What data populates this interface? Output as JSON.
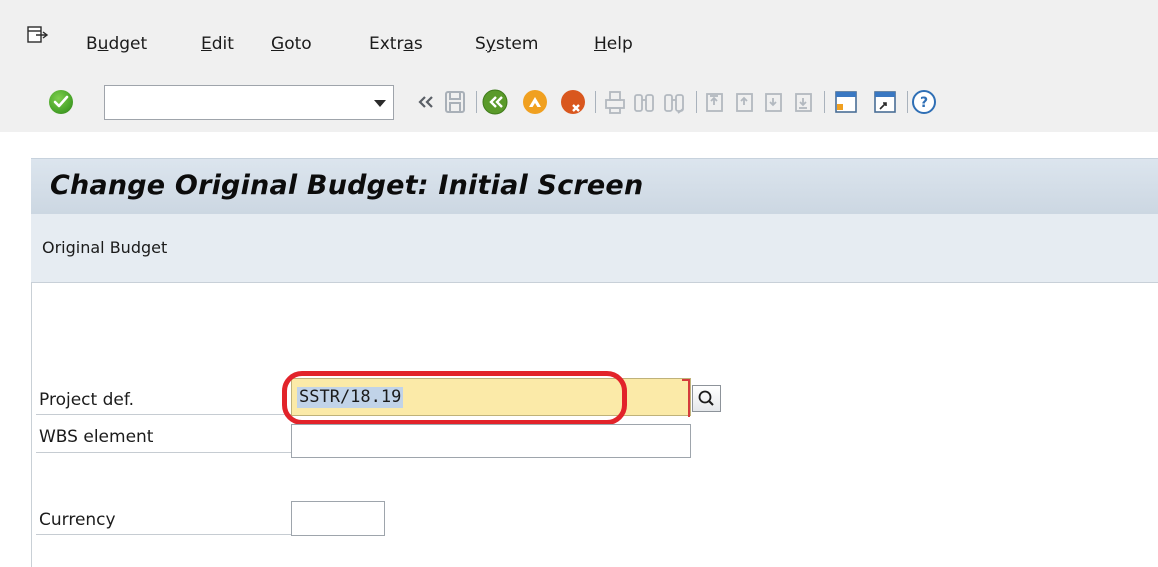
{
  "menu": {
    "items": [
      {
        "pre": "B",
        "ul": "u",
        "post": "dget"
      },
      {
        "pre": "",
        "ul": "E",
        "post": "dit"
      },
      {
        "pre": "",
        "ul": "G",
        "post": "oto"
      },
      {
        "pre": "Extr",
        "ul": "a",
        "post": "s"
      },
      {
        "pre": "S",
        "ul": "y",
        "post": "stem"
      },
      {
        "pre": "",
        "ul": "H",
        "post": "elp"
      }
    ]
  },
  "toolbar": {
    "command_value": "",
    "icons": [
      "enter-icon",
      "back-double-arrow-icon",
      "save-icon",
      "back-icon",
      "exit-icon",
      "cancel-icon",
      "print-icon",
      "find-icon",
      "find-next-icon",
      "first-page-icon",
      "previous-page-icon",
      "next-page-icon",
      "last-page-icon",
      "create-session-icon",
      "generate-shortcut-icon",
      "help-icon"
    ],
    "colors": {
      "enter": "#4aa52a",
      "back": "#5a9a2a",
      "exit": "#f0a020",
      "cancel": "#d9571e"
    }
  },
  "title": "Change Original Budget: Initial Screen",
  "application_toolbar": {
    "original_budget_label": "Original Budget"
  },
  "form": {
    "project_def_label": "Project def.",
    "project_def_value": "SSTR/18.19",
    "wbs_label": "WBS element",
    "wbs_value": "",
    "currency_label": "Currency",
    "currency_value": ""
  },
  "colors": {
    "required_field_bg": "#fbeaa8",
    "highlight": "#e2232a",
    "title_bar": "#d6e0ea"
  }
}
